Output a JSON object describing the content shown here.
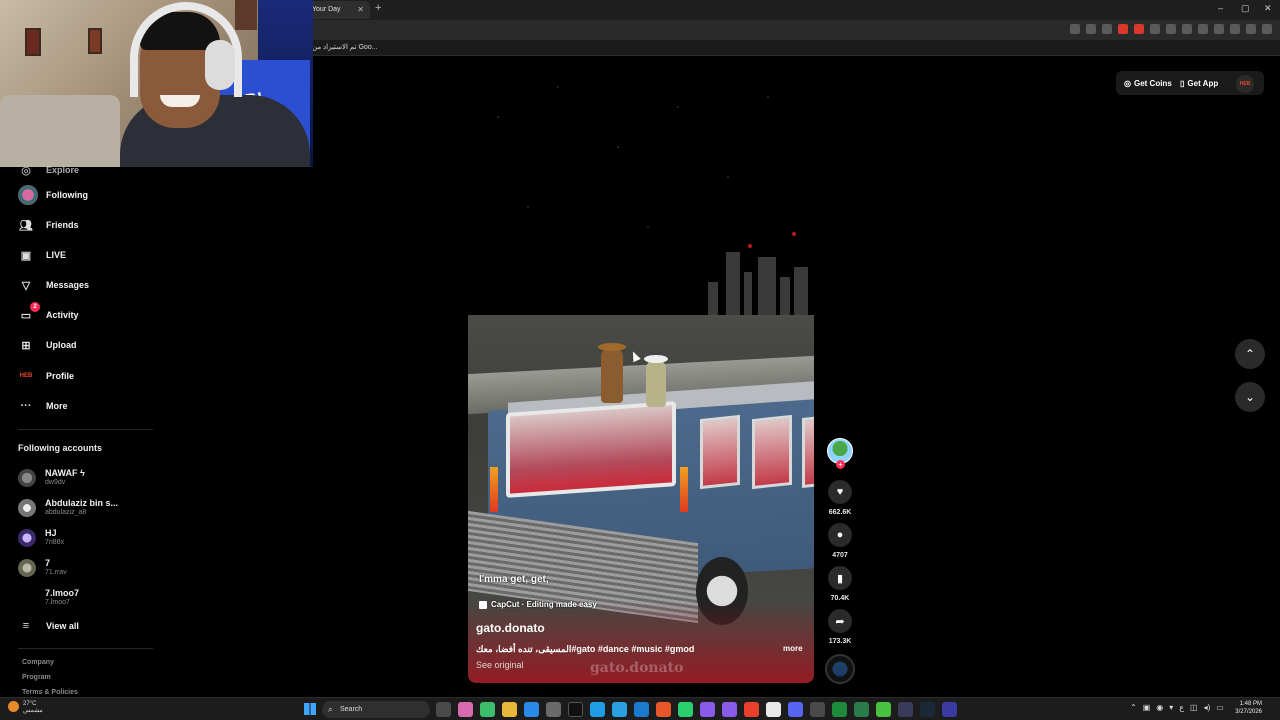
{
  "browser": {
    "tab_title": "Your Day",
    "tab_close": "✕",
    "new_tab": "+",
    "bookmark": "تم الاستيراد من Goo...",
    "window_controls": [
      "–",
      "▢",
      "✕"
    ]
  },
  "webcam": {
    "shirt_text": "ORI"
  },
  "sidebar": {
    "nav": [
      {
        "label": "Explore",
        "icon": "compass-icon"
      },
      {
        "label": "Following",
        "icon": "following-avatar"
      },
      {
        "label": "Friends",
        "icon": "friends-icon"
      },
      {
        "label": "LIVE",
        "icon": "live-icon"
      },
      {
        "label": "Messages",
        "icon": "messages-icon"
      },
      {
        "label": "Activity",
        "icon": "activity-icon",
        "badge": "2"
      },
      {
        "label": "Upload",
        "icon": "upload-icon"
      },
      {
        "label": "Profile",
        "icon": "profile-logo",
        "logo_text": "HEB"
      },
      {
        "label": "More",
        "icon": "more-icon"
      }
    ],
    "following_title": "Following accounts",
    "accounts": [
      {
        "name": "NAWAF ϟ",
        "handle": "dw9dv"
      },
      {
        "name": "Abdulaziz bin s...",
        "handle": "abdulaziz_a8"
      },
      {
        "name": "HJ",
        "handle": "7ri88x"
      },
      {
        "name": "7",
        "handle": "71.rrav"
      },
      {
        "name": "7.lmoo7",
        "handle": "7.lmoo7"
      }
    ],
    "view_all": "View all",
    "footer": [
      "Company",
      "Program",
      "Terms & Policies"
    ]
  },
  "video": {
    "caption_line": "I'mma get, get,",
    "capcut": "CapCut · Editing made easy",
    "author": "gato.donato",
    "description": "المسيقى، تنده أفضا، معك#gato #dance #music #gmod",
    "more": "more",
    "see_original": "See original",
    "watermark": "gato.donato"
  },
  "actions": {
    "likes": "662.6K",
    "comments": "4707",
    "saves": "70.4K",
    "shares": "173.3K"
  },
  "top_right": {
    "get_coins": "Get Coins",
    "get_app": "Get App",
    "avatar_text": "HEB"
  },
  "taskbar": {
    "temp": "27°C",
    "weather_label": "مشمس",
    "search": "Search",
    "time": "1:48 PM",
    "date": "3/27/2026",
    "lang": "ع"
  }
}
